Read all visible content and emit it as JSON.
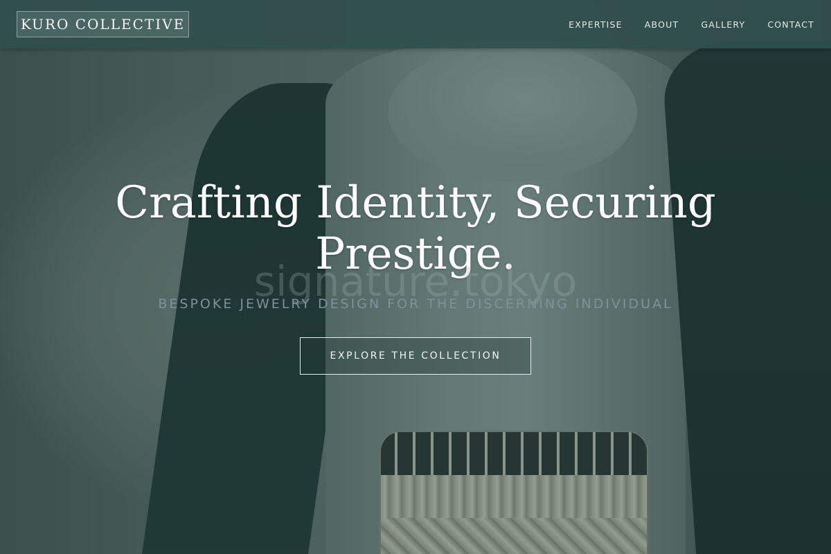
{
  "header": {
    "logo_text": "KURO COLLECTIVE",
    "nav": [
      {
        "label": "EXPERTISE"
      },
      {
        "label": "ABOUT"
      },
      {
        "label": "GALLERY"
      },
      {
        "label": "CONTACT"
      }
    ]
  },
  "hero": {
    "headline": "Crafting Identity, Securing Prestige.",
    "watermark": "signature.tokyo",
    "tagline": "BESPOKE JEWELRY DESIGN FOR THE DISCERNING INDIVIDUAL",
    "cta_label": "EXPLORE THE COLLECTION"
  },
  "colors": {
    "header_bg": "#304e4c",
    "overlay": "#1e3c3a",
    "headline": "#ffffff",
    "tagline": "#7f919c"
  }
}
